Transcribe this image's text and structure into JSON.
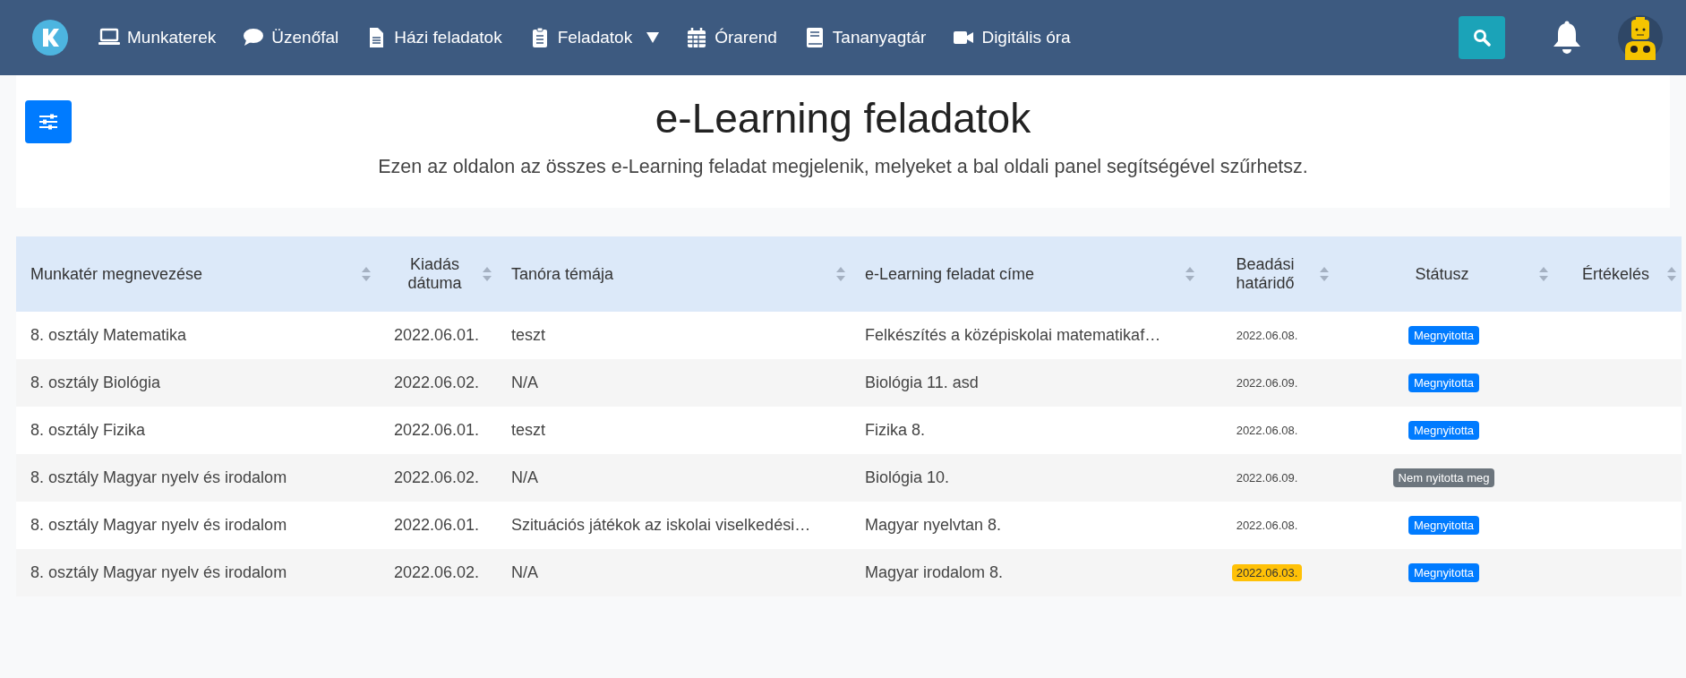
{
  "navbar": {
    "items": [
      {
        "label": "Munkaterek",
        "kind": "link"
      },
      {
        "label": "Üzenőfal",
        "kind": "link"
      },
      {
        "label": "Házi feladatok",
        "kind": "link"
      },
      {
        "label": "Feladatok",
        "kind": "dropdown"
      },
      {
        "label": "Órarend",
        "kind": "link"
      },
      {
        "label": "Tananyagtár",
        "kind": "link"
      },
      {
        "label": "Digitális óra",
        "kind": "link"
      }
    ]
  },
  "header": {
    "title": "e-Learning feladatok",
    "subtitle": "Ezen az oldalon az összes e-Learning feladat megjelenik, melyeket a bal oldali panel segítségével szűrhetsz."
  },
  "table": {
    "columns": [
      "Munkatér megnevezése",
      "Kiadás dátuma",
      "Tanóra témája",
      "e-Learning feladat címe",
      "Beadási határidő",
      "Státusz",
      "Értékelés"
    ],
    "rows": [
      {
        "workspace": "8. osztály Matematika",
        "issued": "2022.06.01.",
        "topic": "teszt",
        "title": "Felkészítés a középiskolai matematikaf…",
        "deadline": "2022.06.08.",
        "overdue": false,
        "status": "Megnyitotta",
        "color": "#007bff"
      },
      {
        "workspace": "8. osztály Biológia",
        "issued": "2022.06.02.",
        "topic": "N/A",
        "title": "Biológia 11. asd",
        "deadline": "2022.06.09.",
        "overdue": false,
        "status": "Megnyitotta",
        "color": "#007bff"
      },
      {
        "workspace": "8. osztály Fizika",
        "issued": "2022.06.01.",
        "topic": "teszt",
        "title": "Fizika 8.",
        "deadline": "2022.06.08.",
        "overdue": false,
        "status": "Megnyitotta",
        "color": "#007bff"
      },
      {
        "workspace": "8. osztály Magyar nyelv és irodalom",
        "issued": "2022.06.02.",
        "topic": "N/A",
        "title": "Biológia 10.",
        "deadline": "2022.06.09.",
        "overdue": false,
        "status": "Nem nyitotta meg",
        "color": "#6c757d"
      },
      {
        "workspace": "8. osztály Magyar nyelv és irodalom",
        "issued": "2022.06.01.",
        "topic": "Szituációs játékok az iskolai viselkedési…",
        "title": "Magyar nyelvtan 8.",
        "deadline": "2022.06.08.",
        "overdue": false,
        "status": "Megnyitotta",
        "color": "#007bff"
      },
      {
        "workspace": "8. osztály Magyar nyelv és irodalom",
        "issued": "2022.06.02.",
        "topic": "N/A",
        "title": "Magyar irodalom 8.",
        "deadline": "2022.06.03.",
        "overdue": true,
        "status": "Megnyitotta",
        "color": "#007bff"
      }
    ]
  }
}
